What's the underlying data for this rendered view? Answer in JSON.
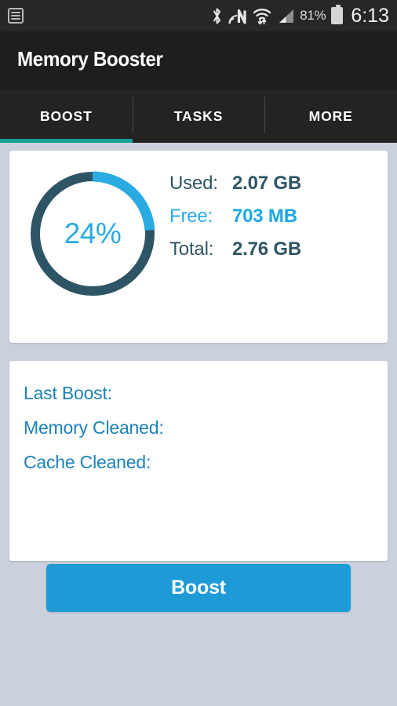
{
  "status_bar": {
    "notification_icon": "list-notification-icon",
    "icons": [
      "bluetooth-icon",
      "nfc-icon",
      "wifi-icon",
      "cellular-signal-icon"
    ],
    "battery_percent": "81%",
    "battery_icon": "battery-icon",
    "time": "6:13"
  },
  "app_bar": {
    "title": "Memory Booster"
  },
  "tabs": {
    "items": [
      {
        "label": "BOOST",
        "active": true
      },
      {
        "label": "TASKS",
        "active": false
      },
      {
        "label": "MORE",
        "active": false
      }
    ],
    "active_indicator_color": "#16a195"
  },
  "memory_card": {
    "gauge": {
      "percent_label": "24%",
      "percent_value": 24,
      "arc_color": "#29abe2",
      "track_color": "#2e5565"
    },
    "stats": [
      {
        "label": "Used:",
        "value": "2.07 GB",
        "highlight": false
      },
      {
        "label": "Free:",
        "value": "703 MB",
        "highlight": true
      },
      {
        "label": "Total:",
        "value": "2.76 GB",
        "highlight": false
      }
    ]
  },
  "boost_info_card": {
    "rows": [
      {
        "label": "Last Boost:",
        "value": ""
      },
      {
        "label": "Memory Cleaned:",
        "value": ""
      },
      {
        "label": "Cache Cleaned:",
        "value": ""
      }
    ]
  },
  "boost_button": {
    "label": "Boost",
    "color": "#1e9bd7"
  },
  "colors": {
    "background": "#c9d1dc",
    "card": "#ffffff",
    "accent_blue": "#29abe2",
    "dark_slate": "#2e5565",
    "teal": "#16a195"
  }
}
